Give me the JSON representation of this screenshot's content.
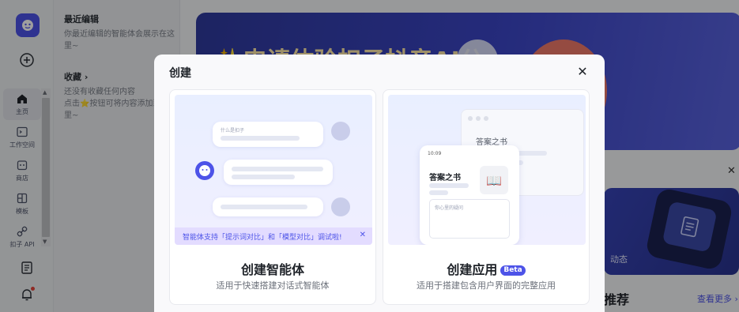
{
  "rail": {
    "items": [
      {
        "label": "主页",
        "icon": "home-icon"
      },
      {
        "label": "工作空间",
        "icon": "workspace-icon"
      },
      {
        "label": "商店",
        "icon": "store-icon"
      },
      {
        "label": "模板",
        "icon": "template-icon"
      },
      {
        "label": "扣子 API",
        "icon": "api-icon"
      }
    ]
  },
  "panel": {
    "recent_title": "最近编辑",
    "recent_empty": "你最近编辑的智能体会展示在这里~",
    "fav_title": "收藏",
    "fav_arrow": "›",
    "fav_empty_1": "还没有收藏任何内容",
    "fav_empty_2": "点击⭐按钮可将内容添加到这里~"
  },
  "main": {
    "banner_title": "✨申请体验扣子抖音AI分",
    "card2_text": "动态",
    "recommend_title": "推荐",
    "see_more": "查看更多 ›"
  },
  "modal": {
    "title": "创建",
    "close": "✕",
    "options": [
      {
        "title": "创建智能体",
        "desc": "适用于快速搭建对话式智能体",
        "bubble_hint": "什么是扣子",
        "tip": "智能体支持「提示词对比」和「模型对比」调试啦!",
        "tip_close": "✕"
      },
      {
        "title": "创建应用",
        "badge": "Beta",
        "desc": "适用于搭建包含用户界面的完整应用",
        "window_title": "答案之书",
        "phone_time": "10:09",
        "phone_title": "答案之书",
        "phone_input_placeholder": "你心里的疑问"
      }
    ]
  },
  "colors": {
    "accent": "#4d53e8",
    "overlay": "rgba(0,0,0,0.38)",
    "notification_dot": "#e5443b"
  }
}
